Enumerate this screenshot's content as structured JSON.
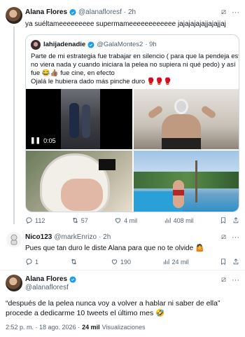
{
  "tweet1": {
    "name": "Alana Flores",
    "handle": "@alanafloresf",
    "time": "· 2h",
    "text": "ya suéltameeeeeeeee supermameeeeeeeeeeee jajajajajajjajajjaj",
    "quote": {
      "name": "lahijadenadie",
      "handle": "@GalaMontes2",
      "time": "· 9h",
      "text_l1": "Parte de mi estrategia fue trabajar en silencio ( para que la pendeja está",
      "text_l2": "no viera nada y cuando iniciara la pelea no supiera ni qué pedo) y así",
      "text_l3": "fue 😂👍🏽 fue cine, en efecto",
      "text_l4": "Ojalá le hubiera dado más pinche duro 🥊🥊🥊",
      "video_time": "0:05"
    },
    "actions": {
      "replies": "112",
      "retweets": "57",
      "likes": "4 mil",
      "views": "408 mil"
    }
  },
  "tweet2": {
    "name": "Nico123",
    "handle": "@markEnrizo",
    "time": "· 2h",
    "text": "Pues que tan duro le diste Alana para que no te olvide 🤷",
    "actions": {
      "replies": "1",
      "retweets": "",
      "likes": "190",
      "views": "24 mil"
    }
  },
  "tweet3": {
    "name": "Alana Flores",
    "handle": "@alanafloresf",
    "text_l1": "“después de la pelea nunca voy a volver a hablar ni saber de ella”",
    "text_l2": "procede a dedicarme 10 tweets el último mes 🤣",
    "timestamp": "2:52 p. m. · 18 ago. 2026 ·",
    "views_count": "24 mil",
    "views_label": "Visualizaciones"
  },
  "colors": {
    "verified": "#1d9bf0",
    "text": "#0f1419",
    "muted": "#536471",
    "border": "#cfd9de"
  }
}
